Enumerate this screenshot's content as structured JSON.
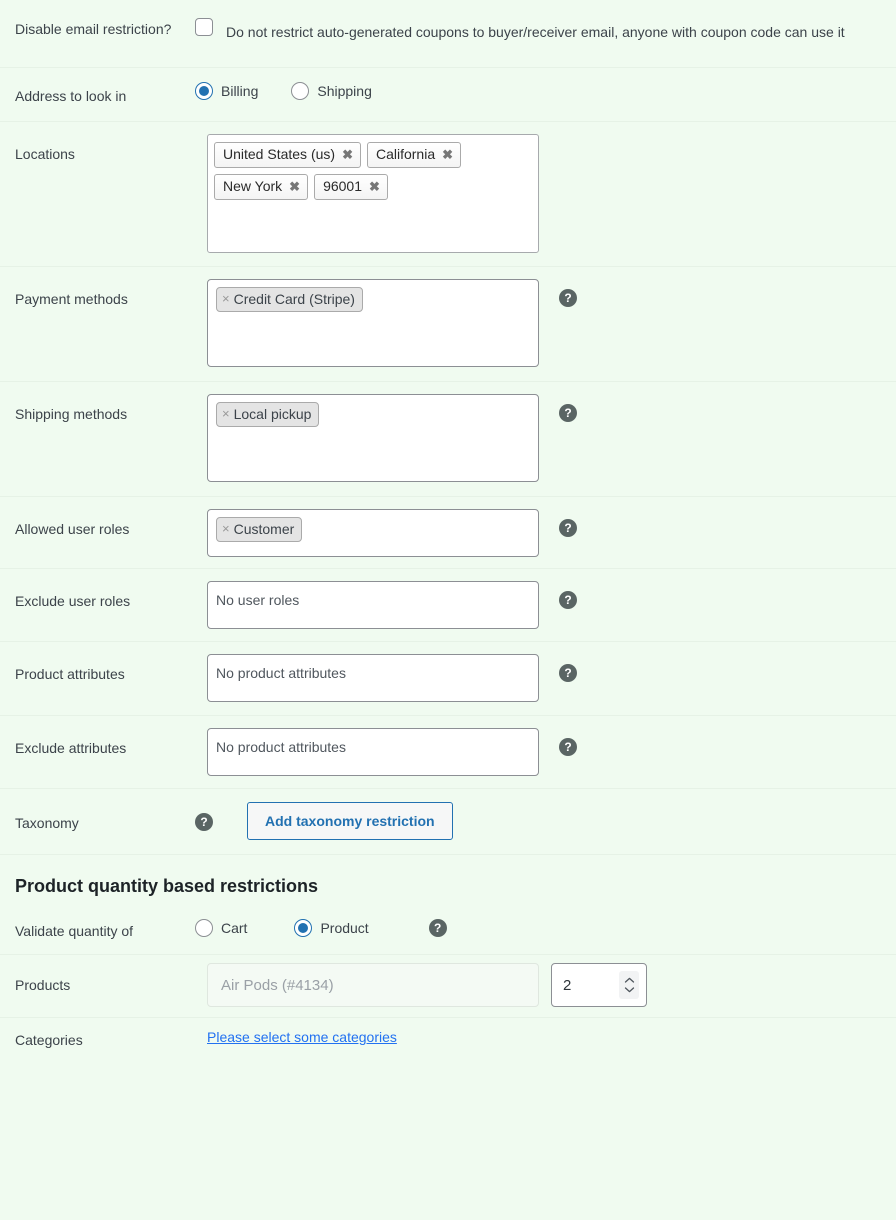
{
  "rows": {
    "disable_email": {
      "label": "Disable email restriction?",
      "description": "Do not restrict auto-generated coupons to buyer/receiver email, anyone with coupon code can use it",
      "checked": false
    },
    "address": {
      "label": "Address to look in",
      "options": [
        {
          "label": "Billing",
          "selected": true
        },
        {
          "label": "Shipping",
          "selected": false
        }
      ]
    },
    "locations": {
      "label": "Locations",
      "chips": [
        {
          "text": "United States (us)",
          "remove": "✖"
        },
        {
          "text": "California",
          "remove": "✖"
        },
        {
          "text": "New York",
          "remove": "✖"
        },
        {
          "text": "96001",
          "remove": "✖"
        }
      ]
    },
    "payment_methods": {
      "label": "Payment methods",
      "tags": [
        {
          "text": "Credit Card (Stripe)",
          "remove": "×"
        }
      ],
      "help": "?"
    },
    "shipping_methods": {
      "label": "Shipping methods",
      "tags": [
        {
          "text": "Local pickup",
          "remove": "×"
        }
      ],
      "help": "?"
    },
    "allowed_user_roles": {
      "label": "Allowed user roles",
      "tags": [
        {
          "text": "Customer",
          "remove": "×"
        }
      ],
      "help": "?"
    },
    "exclude_user_roles": {
      "label": "Exclude user roles",
      "placeholder": "No user roles",
      "help": "?"
    },
    "product_attributes": {
      "label": "Product attributes",
      "placeholder": "No product attributes",
      "help": "?"
    },
    "exclude_attributes": {
      "label": "Exclude attributes",
      "placeholder": "No product attributes",
      "help": "?"
    },
    "taxonomy": {
      "label": "Taxonomy",
      "help": "?",
      "button": "Add taxonomy restriction"
    }
  },
  "section": {
    "title": "Product quantity based restrictions",
    "validate": {
      "label": "Validate quantity of",
      "options": [
        {
          "label": "Cart",
          "selected": false
        },
        {
          "label": "Product",
          "selected": true
        }
      ],
      "help": "?"
    },
    "products": {
      "label": "Products",
      "placeholder": "Air Pods (#4134)",
      "value": "",
      "quantity": "2"
    },
    "categories": {
      "label": "Categories",
      "link": "Please select some categories"
    }
  },
  "colors": {
    "background": "#f0fbf0",
    "accent_blue": "#2271b1",
    "link_blue": "#2271f1",
    "label_text": "#3c434a",
    "help_bg": "#5a6564"
  }
}
